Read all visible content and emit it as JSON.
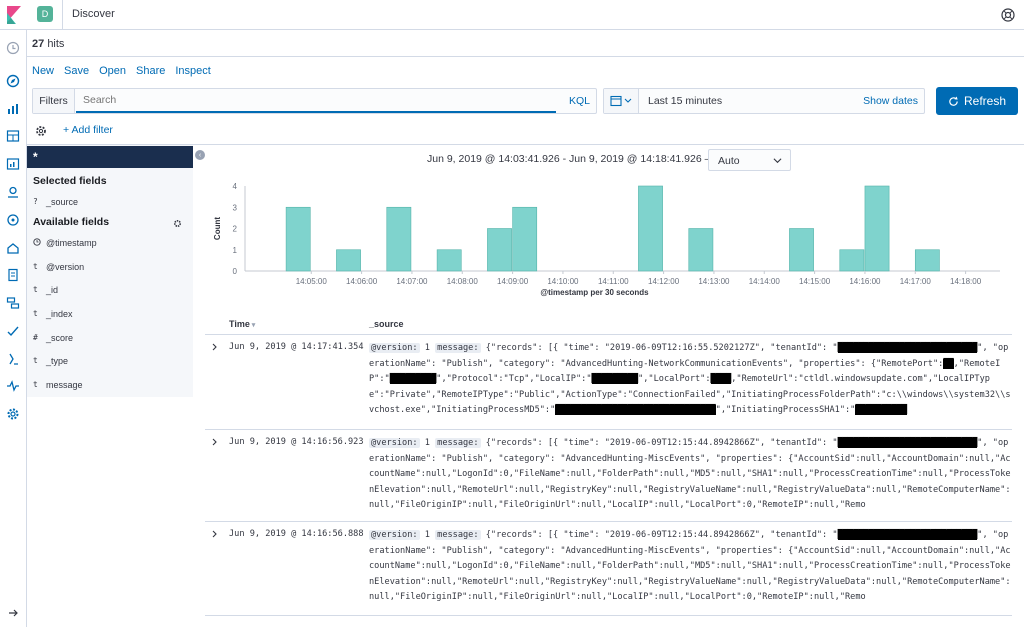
{
  "header": {
    "app_title": "Discover",
    "space_initial": "D"
  },
  "hits": {
    "count": "27",
    "label": "hits"
  },
  "menu": [
    "New",
    "Save",
    "Open",
    "Share",
    "Inspect"
  ],
  "query": {
    "filters_label": "Filters",
    "placeholder": "Search",
    "language": "KQL"
  },
  "time": {
    "range": "Last 15 minutes",
    "show_dates": "Show dates",
    "refresh_label": "Refresh"
  },
  "add_filter": "+ Add filter",
  "sidebar": {
    "index_pattern": "*",
    "selected_title": "Selected fields",
    "selected": [
      {
        "type": "?",
        "name": "_source"
      }
    ],
    "available_title": "Available fields",
    "available": [
      {
        "type": "clock",
        "name": "@timestamp"
      },
      {
        "type": "t",
        "name": "@version"
      },
      {
        "type": "t",
        "name": "_id"
      },
      {
        "type": "t",
        "name": "_index"
      },
      {
        "type": "#",
        "name": "_score"
      },
      {
        "type": "t",
        "name": "_type"
      },
      {
        "type": "t",
        "name": "message"
      }
    ]
  },
  "histogram": {
    "range_text": "Jun 9, 2019 @ 14:03:41.926 - Jun 9, 2019 @ 14:18:41.926 —",
    "interval": "Auto"
  },
  "chart_data": {
    "type": "bar",
    "xlabel": "@timestamp per 30 seconds",
    "ylabel": "Count",
    "ylim": [
      0,
      4
    ],
    "yticks": [
      0,
      1,
      2,
      3,
      4
    ],
    "x_tick_labels": [
      "14:05:00",
      "14:06:00",
      "14:07:00",
      "14:08:00",
      "14:09:00",
      "14:10:00",
      "14:11:00",
      "14:12:00",
      "14:13:00",
      "14:14:00",
      "14:15:00",
      "14:16:00",
      "14:17:00",
      "14:18:00"
    ],
    "x_range": [
      "14:03:41",
      "14:18:41"
    ],
    "bars": [
      {
        "x": "14:04:30",
        "value": 3
      },
      {
        "x": "14:05:30",
        "value": 1
      },
      {
        "x": "14:06:30",
        "value": 3
      },
      {
        "x": "14:07:30",
        "value": 1
      },
      {
        "x": "14:08:30",
        "value": 2
      },
      {
        "x": "14:09:00",
        "value": 3
      },
      {
        "x": "14:11:30",
        "value": 4
      },
      {
        "x": "14:12:30",
        "value": 2
      },
      {
        "x": "14:14:30",
        "value": 2
      },
      {
        "x": "14:15:30",
        "value": 1
      },
      {
        "x": "14:16:00",
        "value": 4
      },
      {
        "x": "14:17:00",
        "value": 1
      }
    ],
    "color": "#7fd3cd",
    "grid": false
  },
  "table": {
    "col_time": "Time",
    "col_source": "_source",
    "rows": [
      {
        "time": "Jun 9, 2019 @ 14:17:41.354",
        "version_key": "@version:",
        "version_val": "1",
        "message_key": "message:",
        "text": "{\"records\": [{ \"time\": \"2019-06-09T12:16:55.5202127Z\", \"tenantId\": \"███████████████████████████\", \"operationName\": \"Publish\", \"category\": \"AdvancedHunting-NetworkCommunicationEvents\", \"properties\": {\"RemotePort\":██,\"RemoteIP\":\"█████████\",\"Protocol\":\"Tcp\",\"LocalIP\":\"█████████\",\"LocalPort\":████,\"RemoteUrl\":\"ctldl.windowsupdate.com\",\"LocalIPType\":\"Private\",\"RemoteIPType\":\"Public\",\"ActionType\":\"ConnectionFailed\",\"InitiatingProcessFolderPath\":\"c:\\\\windows\\\\system32\\\\svchost.exe\",\"InitiatingProcessMD5\":\"███████████████████████████████\",\"InitiatingProcessSHA1\":\"██████████"
      },
      {
        "time": "Jun 9, 2019 @ 14:16:56.923",
        "version_key": "@version:",
        "version_val": "1",
        "message_key": "message:",
        "text": "{\"records\": [{ \"time\": \"2019-06-09T12:15:44.8942866Z\", \"tenantId\": \"███████████████████████████\", \"operationName\": \"Publish\", \"category\": \"AdvancedHunting-MiscEvents\", \"properties\": {\"AccountSid\":null,\"AccountDomain\":null,\"AccountName\":null,\"LogonId\":0,\"FileName\":null,\"FolderPath\":null,\"MD5\":null,\"SHA1\":null,\"ProcessCreationTime\":null,\"ProcessTokenElevation\":null,\"RemoteUrl\":null,\"RegistryKey\":null,\"RegistryValueName\":null,\"RegistryValueData\":null,\"RemoteComputerName\":null,\"FileOriginIP\":null,\"FileOriginUrl\":null,\"LocalIP\":null,\"LocalPort\":0,\"RemoteIP\":null,\"Remo"
      },
      {
        "time": "Jun 9, 2019 @ 14:16:56.888",
        "version_key": "@version:",
        "version_val": "1",
        "message_key": "message:",
        "text": "{\"records\": [{ \"time\": \"2019-06-09T12:15:44.8942866Z\", \"tenantId\": \"███████████████████████████\", \"operationName\": \"Publish\", \"category\": \"AdvancedHunting-MiscEvents\", \"properties\": {\"AccountSid\":null,\"AccountDomain\":null,\"AccountName\":null,\"LogonId\":0,\"FileName\":null,\"FolderPath\":null,\"MD5\":null,\"SHA1\":null,\"ProcessCreationTime\":null,\"ProcessTokenElevation\":null,\"RemoteUrl\":null,\"RegistryKey\":null,\"RegistryValueName\":null,\"RegistryValueData\":null,\"RemoteComputerName\":null,\"FileOriginIP\":null,\"FileOriginUrl\":null,\"LocalIP\":null,\"LocalPort\":0,\"RemoteIP\":null,\"Remo"
      }
    ]
  }
}
